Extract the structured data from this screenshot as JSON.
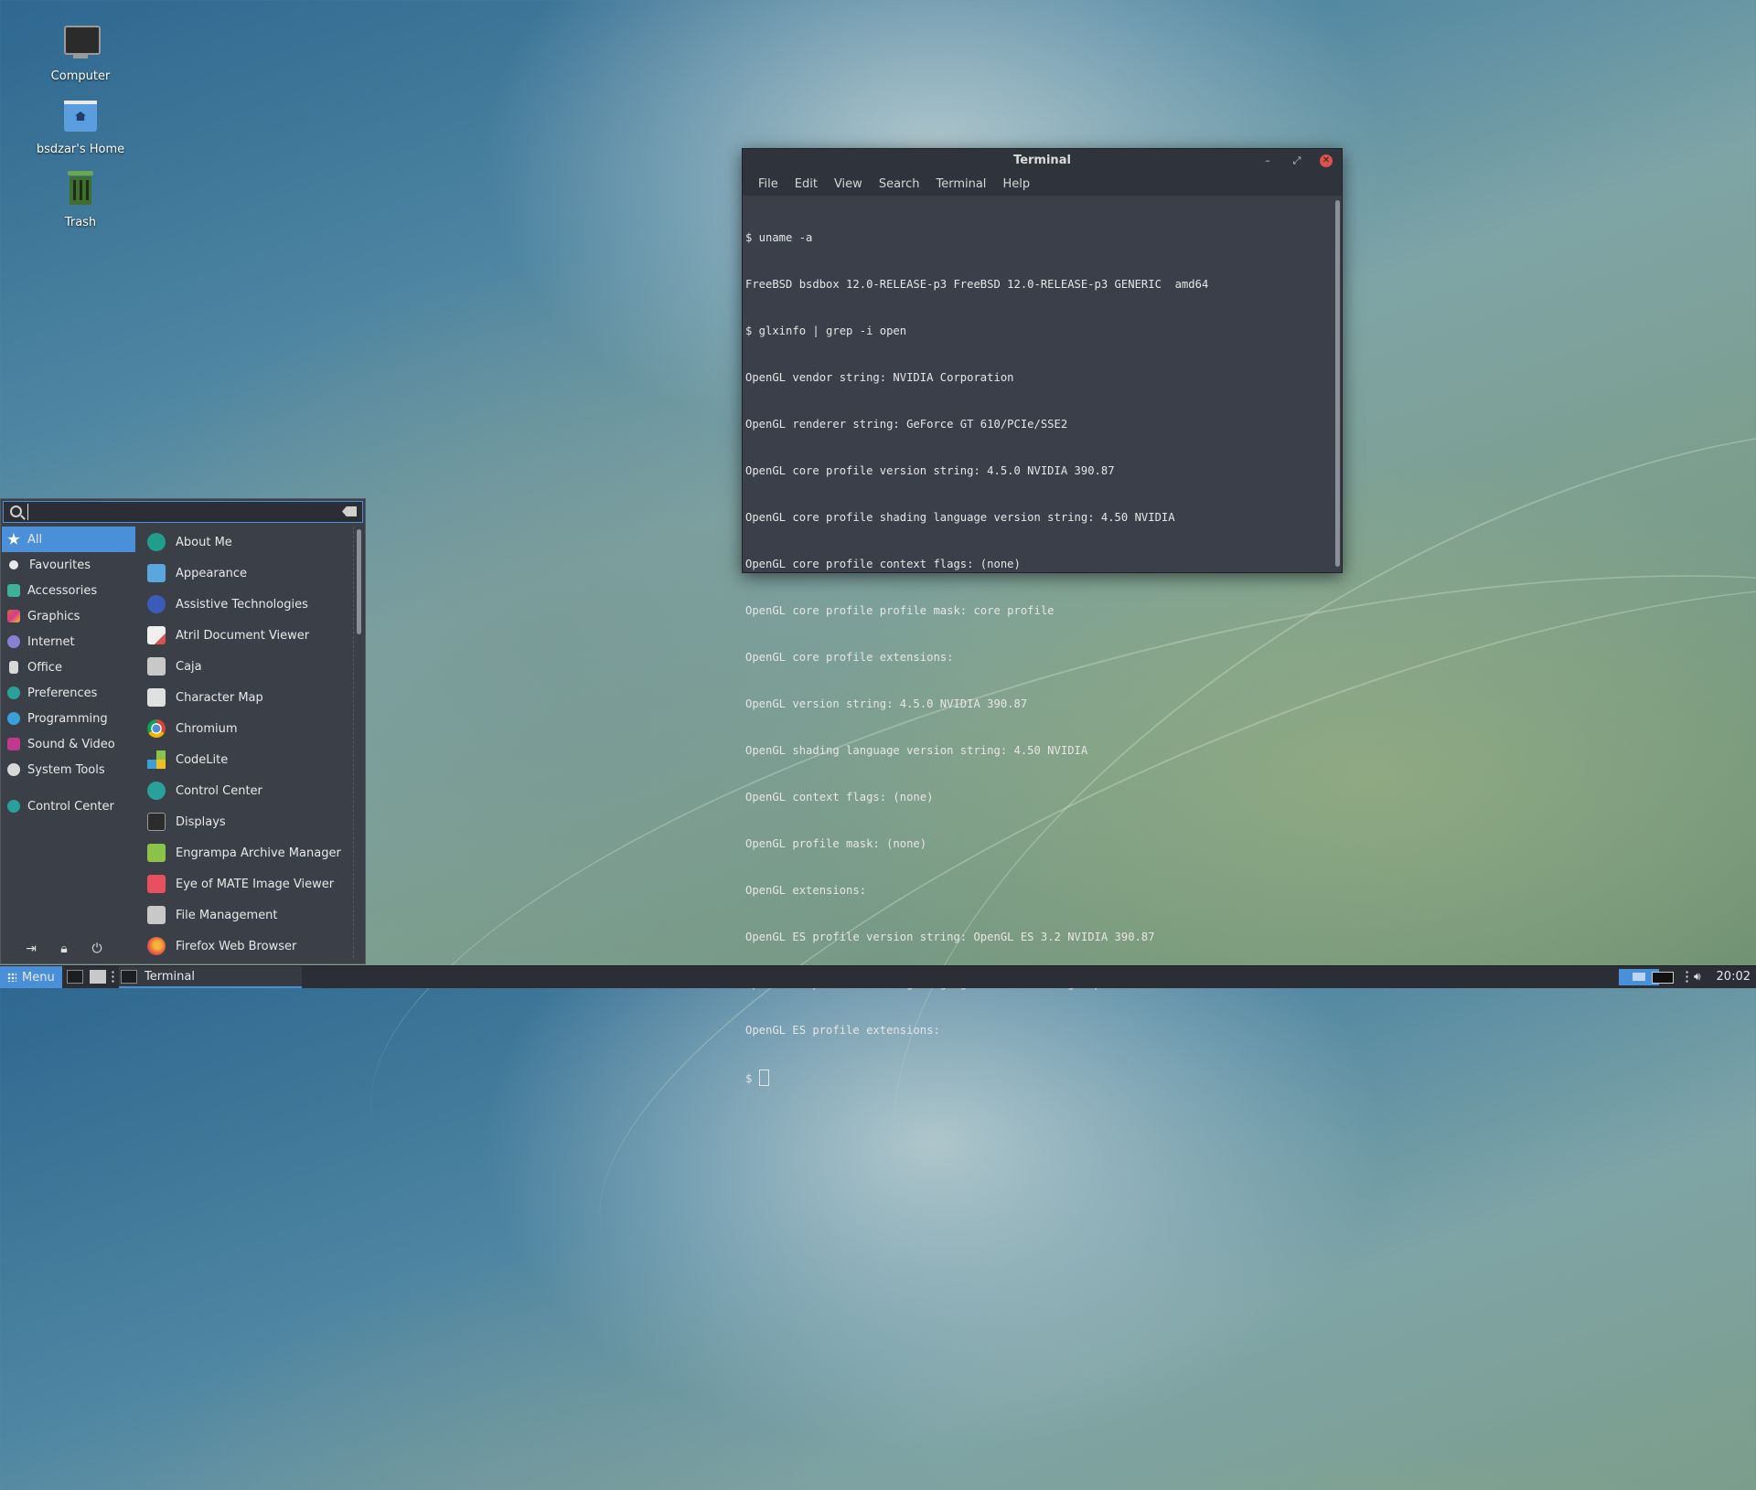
{
  "desktop": {
    "icons": [
      {
        "label": "Computer"
      },
      {
        "label": "bsdzar's Home"
      },
      {
        "label": "Trash"
      }
    ]
  },
  "terminal": {
    "title": "Terminal",
    "menu": [
      "File",
      "Edit",
      "View",
      "Search",
      "Terminal",
      "Help"
    ],
    "lines": [
      "$ uname -a",
      "FreeBSD bsdbox 12.0-RELEASE-p3 FreeBSD 12.0-RELEASE-p3 GENERIC  amd64",
      "$ glxinfo | grep -i open",
      "OpenGL vendor string: NVIDIA Corporation",
      "OpenGL renderer string: GeForce GT 610/PCIe/SSE2",
      "OpenGL core profile version string: 4.5.0 NVIDIA 390.87",
      "OpenGL core profile shading language version string: 4.50 NVIDIA",
      "OpenGL core profile context flags: (none)",
      "OpenGL core profile profile mask: core profile",
      "OpenGL core profile extensions:",
      "OpenGL version string: 4.5.0 NVIDIA 390.87",
      "OpenGL shading language version string: 4.50 NVIDIA",
      "OpenGL context flags: (none)",
      "OpenGL profile mask: (none)",
      "OpenGL extensions:",
      "OpenGL ES profile version string: OpenGL ES 3.2 NVIDIA 390.87",
      "OpenGL ES profile shading language version string: OpenGL ES GLSL ES 3.20",
      "OpenGL ES profile extensions:"
    ],
    "prompt": "$ "
  },
  "app_menu": {
    "search_value": "",
    "categories": [
      {
        "label": "All",
        "color": "#4a90d9",
        "selected": true
      },
      {
        "label": "Favourites",
        "color": "#e8e8e8"
      },
      {
        "label": "Accessories",
        "color": "#3fb09a"
      },
      {
        "label": "Graphics",
        "color": "#e0663a"
      },
      {
        "label": "Internet",
        "color": "#8a7fd0"
      },
      {
        "label": "Office",
        "color": "#d8d8d8"
      },
      {
        "label": "Preferences",
        "color": "#2aa198"
      },
      {
        "label": "Programming",
        "color": "#3aa0d8"
      },
      {
        "label": "Sound & Video",
        "color": "#c0398c"
      },
      {
        "label": "System Tools",
        "color": "#d8d8d8"
      }
    ],
    "control_center": {
      "label": "Control Center",
      "color": "#2aa198"
    },
    "apps": [
      {
        "label": "About Me",
        "color": "#1f9e8a"
      },
      {
        "label": "Appearance",
        "color": "#5aa7e0"
      },
      {
        "label": "Assistive Technologies",
        "color": "#3a5bb8"
      },
      {
        "label": "Atril Document Viewer",
        "color": "#e8e8e8"
      },
      {
        "label": "Caja",
        "color": "#c8c8c8"
      },
      {
        "label": "Character Map",
        "color": "#e0e0e0"
      },
      {
        "label": "Chromium",
        "color": "#4a90d9"
      },
      {
        "label": "CodeLite",
        "color": "#f0c020"
      },
      {
        "label": "Control Center",
        "color": "#2aa198"
      },
      {
        "label": "Displays",
        "color": "#2c2c2c"
      },
      {
        "label": "Engrampa Archive Manager",
        "color": "#8bc34a"
      },
      {
        "label": "Eye of MATE Image Viewer",
        "color": "#e85060"
      },
      {
        "label": "File Management",
        "color": "#c8c8c8"
      },
      {
        "label": "Firefox Web Browser",
        "color": "#e8693a"
      }
    ]
  },
  "taskbar": {
    "menu_label": "Menu",
    "task_label": "Terminal",
    "clock": "20:02",
    "accent": "#4a90d9"
  }
}
